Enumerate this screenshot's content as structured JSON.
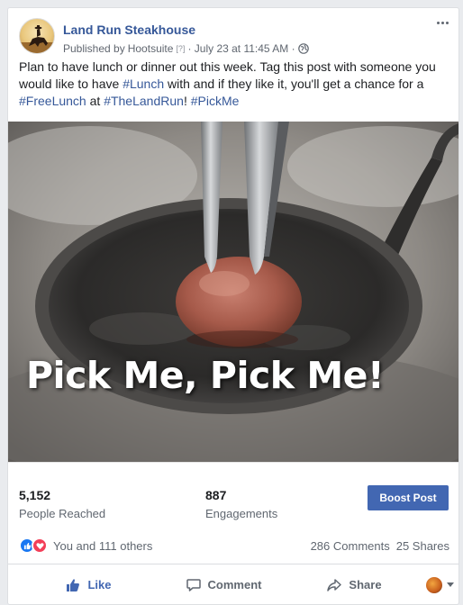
{
  "post": {
    "page_name": "Land Run Steakhouse",
    "published_by_prefix": "Published by",
    "publisher": "Hootsuite",
    "help_marker": "[?]",
    "date": "· July 23 at 11:45 AM ·",
    "text_1": "Plan to have lunch or dinner out this week. Tag this post with someone you would like to have ",
    "tag_lunch": "#Lunch",
    "text_2": " with and if they like it, you'll get a chance for a ",
    "tag_freelunch": "#FreeLunch",
    "text_3": " at ",
    "tag_thelandrun": "#TheLandRun",
    "text_4": "! ",
    "tag_pickme": "#PickMe",
    "image_caption": "Pick Me, Pick Me!"
  },
  "insights": {
    "reached_value": "5,152",
    "reached_label": "People Reached",
    "engagements_value": "887",
    "engagements_label": "Engagements",
    "boost_label": "Boost Post"
  },
  "reactions": {
    "summary": "You and 111 others",
    "comments": "286 Comments",
    "shares": "25 Shares"
  },
  "actions": {
    "like": "Like",
    "comment": "Comment",
    "share": "Share"
  },
  "colors": {
    "link": "#365899",
    "boost": "#4267b2",
    "like_reaction": "#1877f2",
    "love_reaction": "#f33e58"
  },
  "icons": [
    "more-options-icon",
    "globe-icon",
    "like-reaction-icon",
    "love-reaction-icon",
    "thumbs-up-icon",
    "comment-icon",
    "share-icon",
    "dropdown-caret-icon"
  ]
}
